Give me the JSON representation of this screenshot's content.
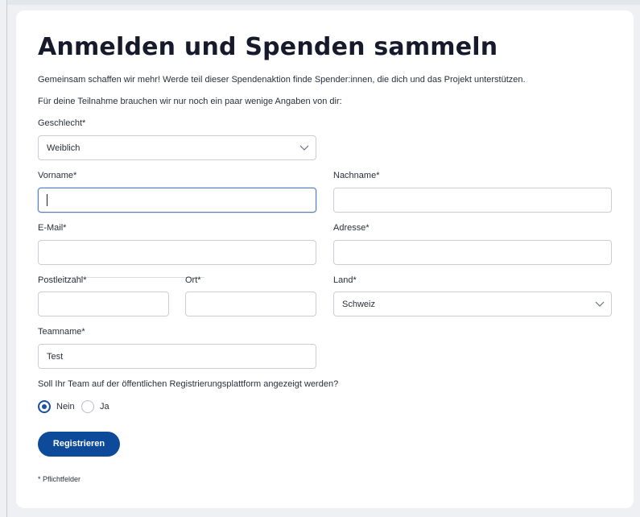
{
  "title": "Anmelden und Spenden sammeln",
  "intro": "Gemeinsam schaffen wir mehr! Werde teil dieser Spendenaktion finde Spender:innen, die dich und das Projekt unterstützen.",
  "intro2": "Für deine Teilnahme brauchen wir nur noch ein paar wenige Angaben von dir:",
  "gender": {
    "label": "Geschlecht*",
    "value": "Weiblich"
  },
  "firstname": {
    "label": "Vorname*",
    "value": ""
  },
  "lastname": {
    "label": "Nachname*",
    "value": ""
  },
  "email": {
    "label": "E-Mail*",
    "value": ""
  },
  "address": {
    "label": "Adresse*",
    "value": ""
  },
  "zip": {
    "label": "Postleitzahl*",
    "value": ""
  },
  "city": {
    "label": "Ort*",
    "value": ""
  },
  "country": {
    "label": "Land*",
    "value": "Schweiz"
  },
  "team": {
    "label": "Teamname*",
    "value": "Test"
  },
  "visibility": {
    "question": "Soll Ihr Team auf der öffentlichen Registrierungsplattform angezeigt werden?",
    "options": [
      "Nein",
      "Ja"
    ],
    "selected": "Nein"
  },
  "submit_label": "Registrieren",
  "footnote": "* Pflichtfelder",
  "icons": {
    "select_chevron": "chevron-down-icon"
  },
  "colors": {
    "primary": "#0d4a9a",
    "focus_border": "#5a7fb8"
  }
}
